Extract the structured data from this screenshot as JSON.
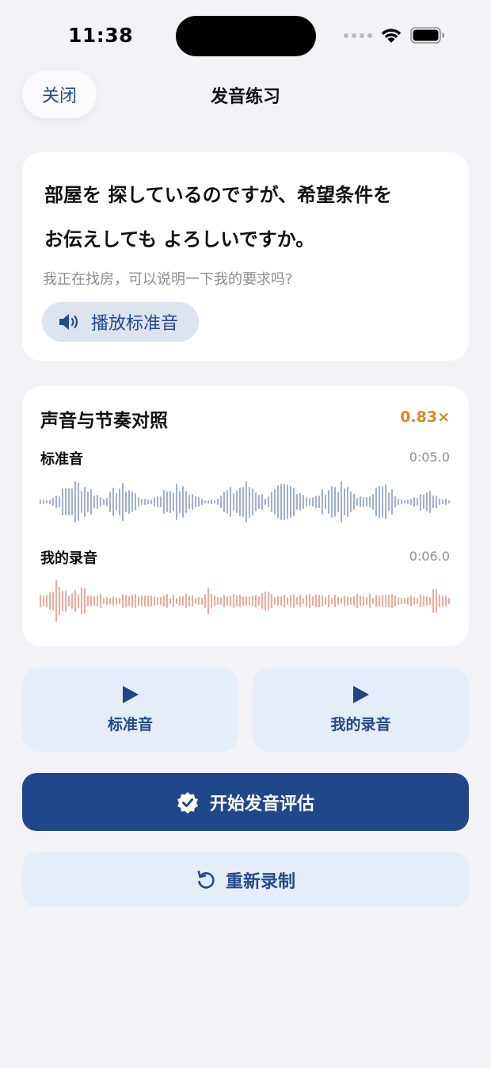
{
  "status_bar": {
    "time": "11:38"
  },
  "nav": {
    "close_label": "关闭",
    "title": "发音练习"
  },
  "sentence": {
    "japanese_line1": "部屋を 探しているのですが、希望条件を",
    "japanese_line2": "お伝えしても よろしいですか。",
    "translation": "我正在找房，可以说明一下我的要求吗?",
    "play_standard_label": "播放标准音"
  },
  "comparison": {
    "title": "声音与节奏对照",
    "speed_ratio": "0.83×",
    "standard": {
      "label": "标准音",
      "duration": "0:05.0",
      "color": "#9fb0cc"
    },
    "mine": {
      "label": "我的录音",
      "duration": "0:06.0",
      "color": "#eeaa9c"
    }
  },
  "playback": {
    "standard_label": "标准音",
    "mine_label": "我的录音"
  },
  "actions": {
    "evaluate_label": "开始发音评估",
    "rerecord_label": "重新录制"
  },
  "colors": {
    "accent": "#20478a",
    "accent_light": "#e5edf9",
    "warning": "#d78a23"
  }
}
